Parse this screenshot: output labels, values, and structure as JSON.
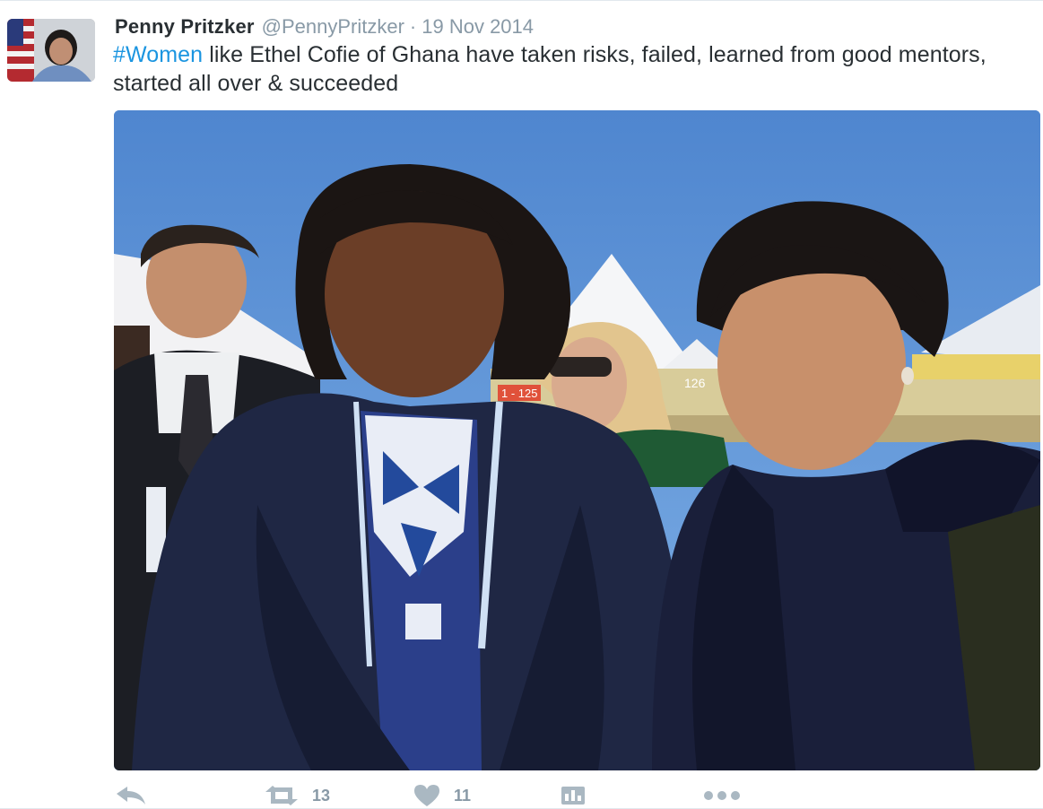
{
  "tweet": {
    "fullname": "Penny Pritzker",
    "username": "@PennyPritzker",
    "separator": "·",
    "time": "19 Nov 2014",
    "hashtag": "#Women",
    "text": " like Ethel Cofie of Ghana have taken risks, failed, learned from good mentors, started all over & succeeded",
    "photo_sign_left": "1 - 125",
    "photo_sign_mid": "126"
  },
  "actions": {
    "reply_icon": "reply-icon",
    "retweet_icon": "retweet-icon",
    "retweet_count": "13",
    "like_icon": "heart-icon",
    "like_count": "11",
    "analytics_icon": "analytics-icon",
    "more_icon": "more-icon"
  },
  "colors": {
    "hashtag": "#1b95e0",
    "muted": "#8899a6",
    "text": "#292f33",
    "action_icon": "#aab8c2"
  }
}
